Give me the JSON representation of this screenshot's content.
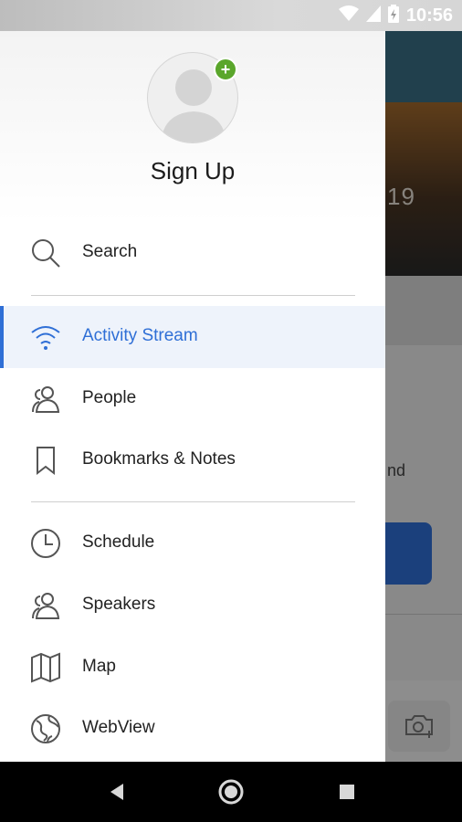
{
  "status_bar": {
    "time": "10:56",
    "icons": [
      "wifi-icon",
      "signal-icon",
      "battery-charging-icon"
    ]
  },
  "drawer": {
    "profile_title": "Sign Up",
    "menu": [
      {
        "label": "Search",
        "icon": "search-icon",
        "active": false
      },
      {
        "label": "Activity Stream",
        "icon": "wifi-stream-icon",
        "active": true
      },
      {
        "label": "People",
        "icon": "people-icon",
        "active": false
      },
      {
        "label": "Bookmarks & Notes",
        "icon": "bookmark-icon",
        "active": false
      },
      {
        "label": "Schedule",
        "icon": "clock-icon",
        "active": false
      },
      {
        "label": "Speakers",
        "icon": "speakers-icon",
        "active": false
      },
      {
        "label": "Map",
        "icon": "map-icon",
        "active": false
      },
      {
        "label": "WebView",
        "icon": "globe-icon",
        "active": false
      }
    ]
  },
  "background": {
    "hero_year_fragment": "19",
    "text_fragment": "nd"
  },
  "colors": {
    "accent": "#2f6fd6",
    "active_bg": "#eef3fb",
    "badge_green": "#5aa62b"
  },
  "nav_bar": [
    "back-icon",
    "home-icon",
    "recents-icon"
  ]
}
